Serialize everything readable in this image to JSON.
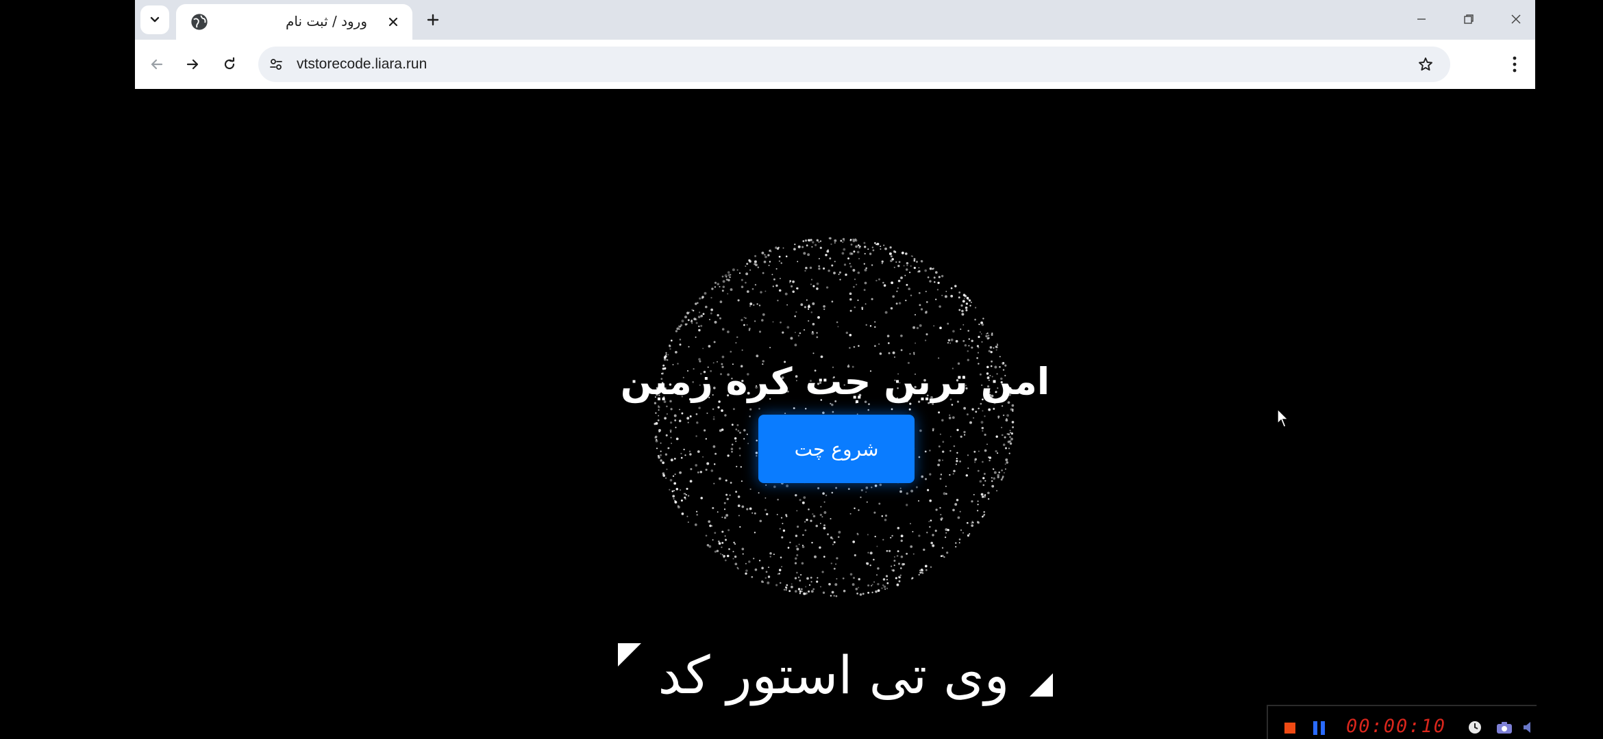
{
  "browser": {
    "tab": {
      "title": "ورود / ثبت نام",
      "favicon": "globe-icon"
    },
    "address_bar": {
      "url": "vtstorecode.liara.run"
    },
    "icons": {
      "tab_search": "chevron-down-icon",
      "close_tab": "close-icon",
      "new_tab": "plus-icon",
      "back": "arrow-left-icon",
      "forward": "arrow-right-icon",
      "reload": "reload-icon",
      "site_info": "tune-icon",
      "bookmark": "star-icon",
      "menu": "kebab-menu-icon",
      "minimize": "minimize-icon",
      "restore": "restore-icon",
      "close_window": "close-icon"
    }
  },
  "page": {
    "hero_title": "امن ترین چت کره زمین",
    "start_button": "شروع چت",
    "brand_text": "وی تی استور کد",
    "colors": {
      "background": "#000000",
      "button": "#0a7cff",
      "text": "#ffffff"
    }
  },
  "recorder": {
    "time": "00:00:10",
    "colors": {
      "stop": "#f04a14",
      "pause": "#2a6bff",
      "time": "#d9261c"
    }
  }
}
